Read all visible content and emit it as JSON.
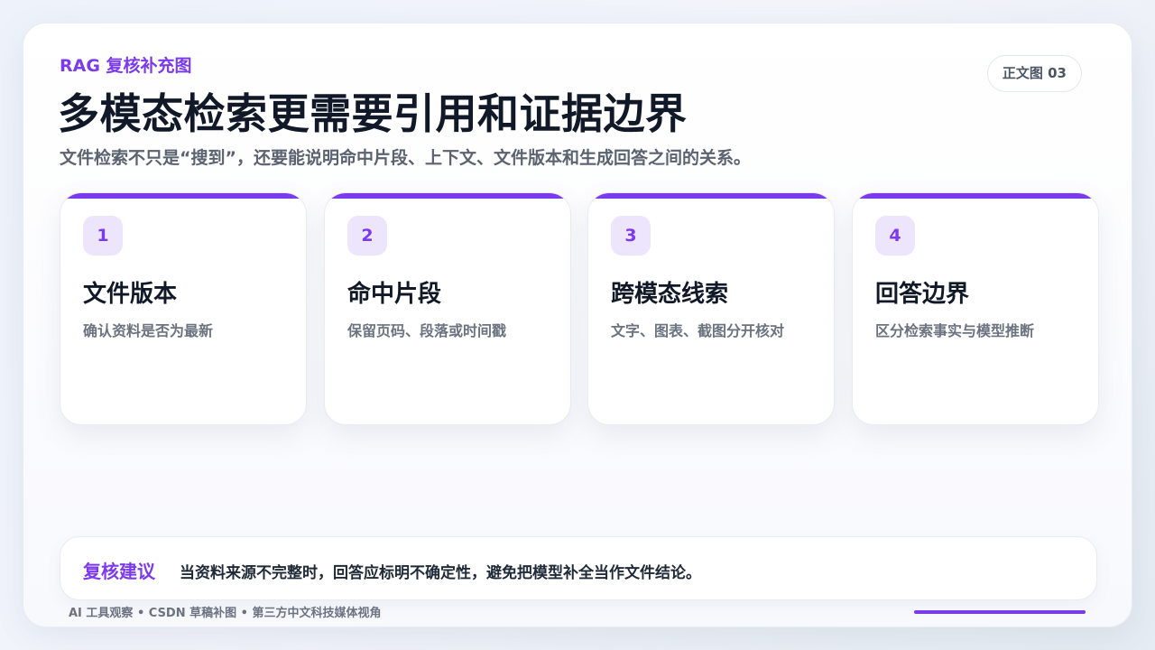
{
  "header": {
    "eyebrow": "RAG 复核补充图",
    "page_tag": "正文图 03",
    "title": "多模态检索更需要引用和证据边界",
    "subtitle": "文件检索不只是“搜到”，还要能说明命中片段、上下文、文件版本和生成回答之间的关系。"
  },
  "cards": [
    {
      "number": "1",
      "title": "文件版本",
      "description": "确认资料是否为最新"
    },
    {
      "number": "2",
      "title": "命中片段",
      "description": "保留页码、段落或时间戳"
    },
    {
      "number": "3",
      "title": "跨模态线索",
      "description": "文字、图表、截图分开核对"
    },
    {
      "number": "4",
      "title": "回答边界",
      "description": "区分检索事实与模型推断"
    }
  ],
  "advice": {
    "label": "复核建议",
    "text": "当资料来源不完整时，回答应标明不确定性，避免把模型补全当作文件结论。"
  },
  "footer": {
    "text": "AI 工具观察 • CSDN 草稿补图 • 第三方中文科技媒体视角"
  },
  "colors": {
    "accent": "#7c3aed",
    "badge_bg": "#ede5fc",
    "title": "#111827",
    "muted": "#6b7280"
  }
}
